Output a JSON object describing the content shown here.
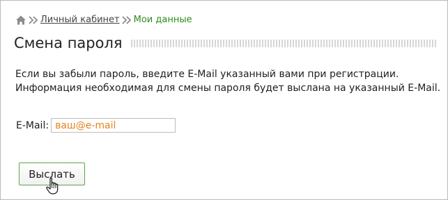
{
  "breadcrumb": {
    "home_icon": "home-icon",
    "separator_icon": "double-chevron-right-icon",
    "link": "Личный кабинет",
    "current": "Мои данные"
  },
  "page": {
    "title": "Смена пароля",
    "info_line1": "Если вы забыли пароль, введите E-Mail указанный вами при регистрации.",
    "info_line2": "Информация необходимая для смены пароля будет выслана на указанный E-Mail."
  },
  "form": {
    "email_label": "E-Mail:",
    "email_placeholder": "ваш@e-mail",
    "email_value": "",
    "submit_label": "Выслать"
  },
  "colors": {
    "accent_green": "#2f8a1f",
    "button_border": "#5aa54a",
    "placeholder_orange": "#e8821c"
  },
  "cursor_icon": "hand-pointer-icon"
}
